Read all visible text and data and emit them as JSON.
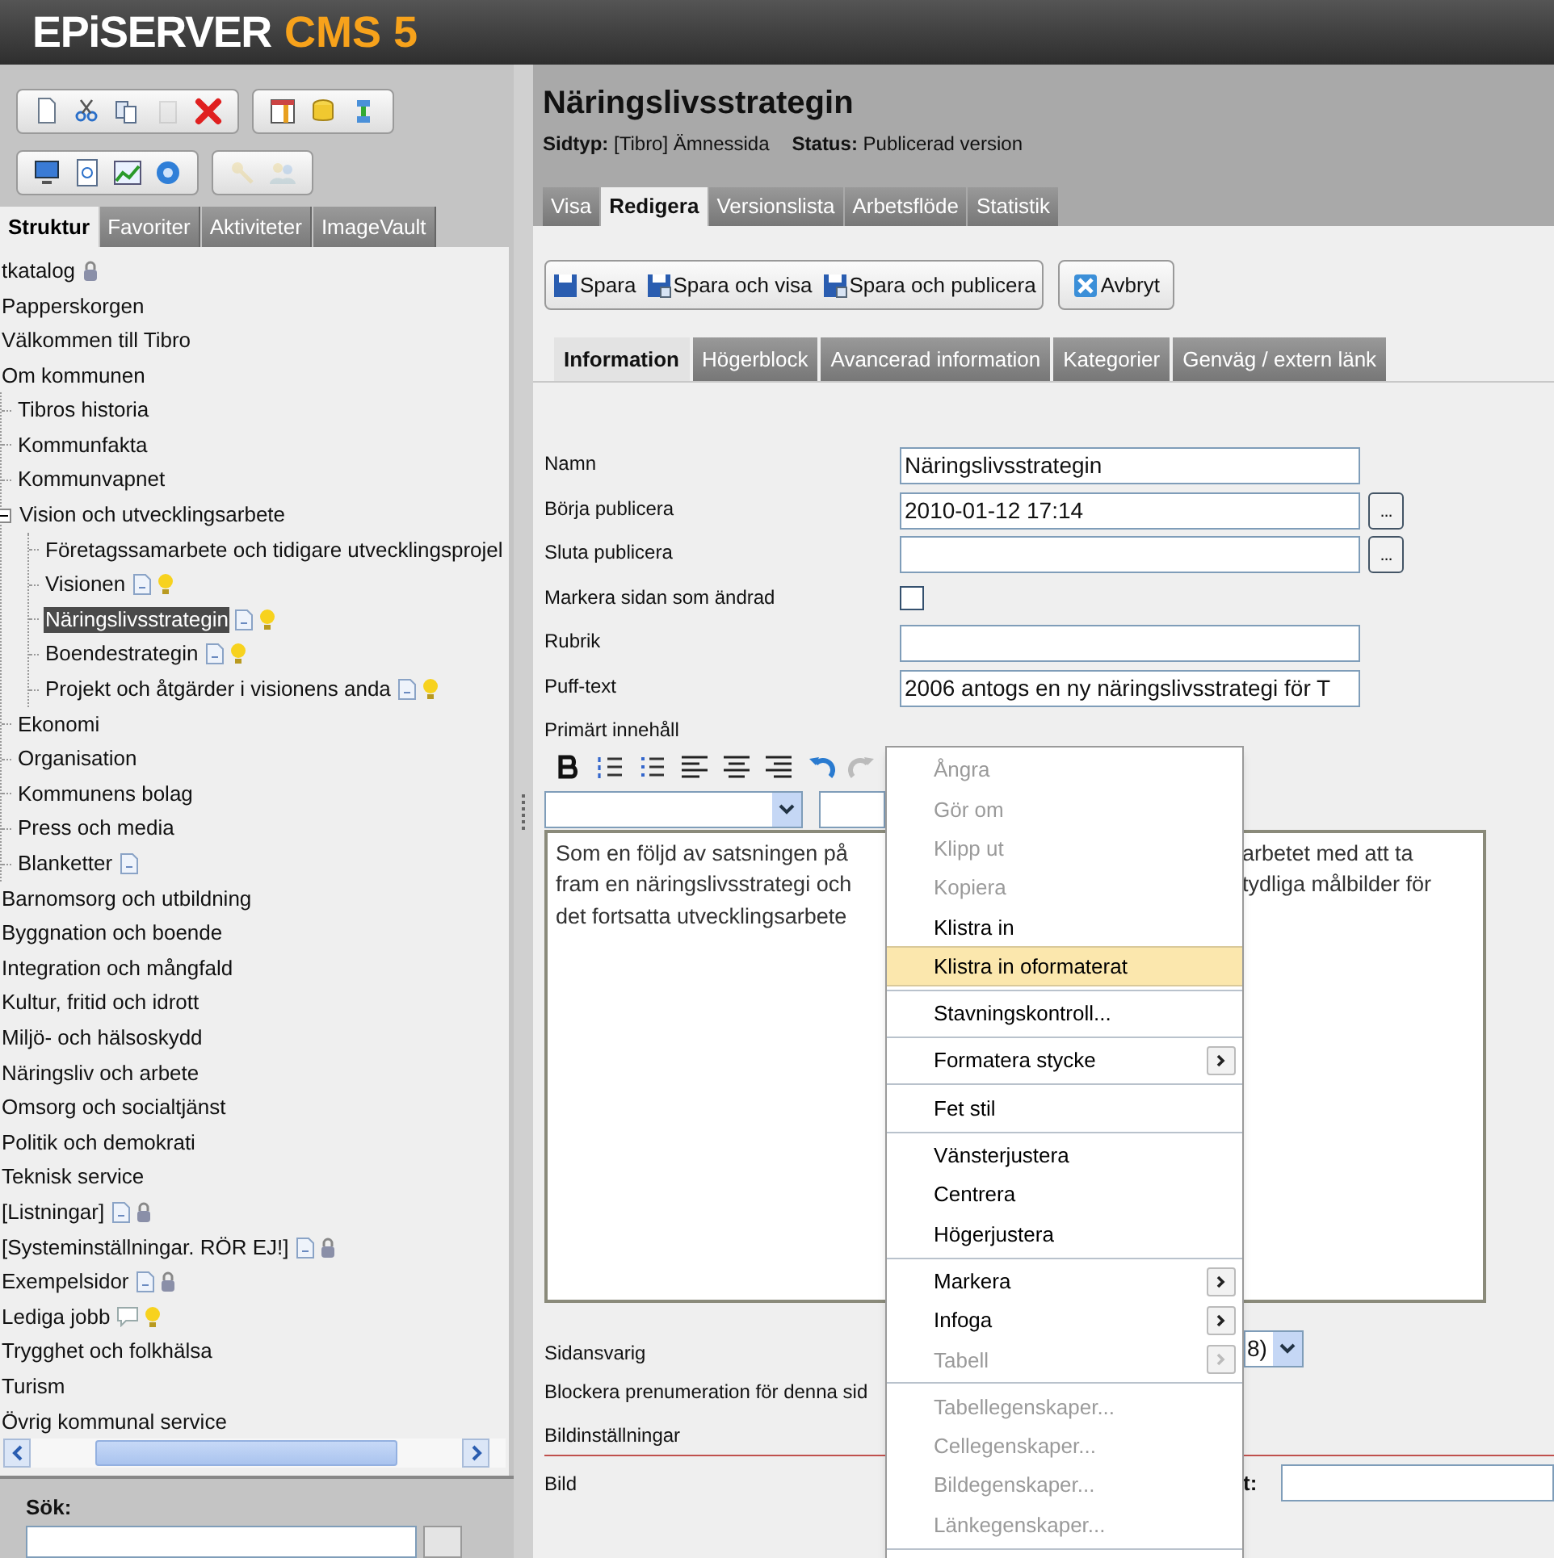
{
  "header": {
    "logo_main": "EPiSERVER",
    "logo_product": "CMS 5"
  },
  "left_toolbar": [
    [
      [
        {
          "disabled": false
        },
        {
          "disabled": false
        },
        {
          "disabled": false
        },
        {
          "disabled": true
        },
        {
          "disabled": false
        }
      ],
      [
        {
          "disabled": false
        },
        {
          "disabled": false
        },
        {
          "disabled": false
        }
      ]
    ],
    [
      [
        {
          "disabled": false
        },
        {
          "disabled": false
        },
        {
          "disabled": false
        },
        {
          "disabled": false
        }
      ],
      [
        {
          "disabled": true
        },
        {
          "disabled": true
        }
      ]
    ]
  ],
  "left_tabs": [
    {
      "label": "Struktur",
      "selected": true
    },
    {
      "label": "Favoriter",
      "selected": false
    },
    {
      "label": "Aktiviteter",
      "selected": false
    },
    {
      "label": "ImageVault",
      "selected": false
    }
  ],
  "tree": [
    {
      "label": "tkatalog",
      "selected": false,
      "lock_icon": true
    },
    {
      "label": "Papperskorgen",
      "selected": false
    },
    {
      "label": "Välkommen till Tibro",
      "selected": false
    },
    {
      "label": "Om kommunen",
      "selected": false,
      "children": [
        {
          "label": "Tibros historia",
          "selected": false
        },
        {
          "label": "Kommunfakta",
          "selected": false
        },
        {
          "label": "Kommunvapnet",
          "selected": false
        },
        {
          "label": "Vision och utvecklingsarbete",
          "selected": false,
          "expanded": true,
          "children": [
            {
              "label": "Företagssamarbete och tidigare utvecklingsprojel",
              "selected": false
            },
            {
              "label": "Visionen",
              "selected": false,
              "page_icon": true,
              "bulb_icon": true
            },
            {
              "label": "Näringslivsstrategin",
              "selected": true,
              "page_icon": true,
              "bulb_icon": true
            },
            {
              "label": "Boendestrategin",
              "selected": false,
              "page_icon": true,
              "bulb_icon": true
            },
            {
              "label": "Projekt och åtgärder i visionens anda",
              "selected": false,
              "page_icon": true,
              "bulb_icon": true
            }
          ]
        },
        {
          "label": "Ekonomi",
          "selected": false
        },
        {
          "label": "Organisation",
          "selected": false
        },
        {
          "label": "Kommunens bolag",
          "selected": false
        },
        {
          "label": "Press och media",
          "selected": false
        },
        {
          "label": "Blanketter",
          "selected": false,
          "page_icon": true
        }
      ]
    },
    {
      "label": "Barnomsorg och utbildning",
      "selected": false
    },
    {
      "label": "Byggnation och boende",
      "selected": false
    },
    {
      "label": "Integration och mångfald",
      "selected": false
    },
    {
      "label": "Kultur, fritid och idrott",
      "selected": false
    },
    {
      "label": "Miljö- och hälsoskydd",
      "selected": false
    },
    {
      "label": "Näringsliv och arbete",
      "selected": false
    },
    {
      "label": "Omsorg och socialtjänst",
      "selected": false
    },
    {
      "label": "Politik och demokrati",
      "selected": false
    },
    {
      "label": "Teknisk service",
      "selected": false
    },
    {
      "label": "[Listningar]",
      "selected": false,
      "page_icon": true,
      "lock_icon": true
    },
    {
      "label": "[Systeminställningar. RÖR EJ!]",
      "selected": false,
      "page_icon": true,
      "lock_icon": true
    },
    {
      "label": "Exempelsidor",
      "selected": false,
      "page_icon": true,
      "lock_icon": true
    },
    {
      "label": "Lediga jobb",
      "selected": false,
      "bubble_icon": true,
      "bulb_icon": true
    },
    {
      "label": "Trygghet och folkhälsa",
      "selected": false
    },
    {
      "label": "Turism",
      "selected": false
    },
    {
      "label": "Övrig kommunal service",
      "selected": false
    }
  ],
  "search": {
    "label": "Sök:"
  },
  "page": {
    "title": "Näringslivsstrategin",
    "meta": [
      {
        "label": "Sidtyp:",
        "value": "[Tibro] Ämnessida"
      },
      {
        "label": "Status:",
        "value": "Publicerad version"
      }
    ]
  },
  "tabs": [
    {
      "label": "Visa",
      "selected": false
    },
    {
      "label": "Redigera",
      "selected": true
    },
    {
      "label": "Versionslista",
      "selected": false
    },
    {
      "label": "Arbetsflöde",
      "selected": false
    },
    {
      "label": "Statistik",
      "selected": false
    }
  ],
  "actions": [
    {
      "label": "Spara"
    },
    {
      "label": "Spara och visa"
    },
    {
      "label": "Spara och publicera"
    }
  ],
  "cancel": {
    "label": "Avbryt"
  },
  "subtabs": [
    {
      "label": "Information",
      "selected": true
    },
    {
      "label": "Högerblock",
      "selected": false
    },
    {
      "label": "Avancerad information",
      "selected": false
    },
    {
      "label": "Kategorier",
      "selected": false
    },
    {
      "label": "Genväg / extern länk",
      "selected": false
    }
  ],
  "fields": [
    {
      "kind": "text",
      "label": "Namn",
      "value": "Näringslivsstrategin"
    },
    {
      "kind": "date",
      "label": "Börja publicera",
      "value": "2010-01-12 17:14",
      "picker": "..."
    },
    {
      "kind": "date",
      "label": "Sluta publicera",
      "picker": "..."
    },
    {
      "kind": "checkbox",
      "label": "Markera sidan som ändrad",
      "checked": false
    },
    {
      "kind": "text",
      "label": "Rubrik"
    },
    {
      "kind": "text",
      "label": "Puff-text",
      "value": "2006 antogs en ny näringslivsstrategi för T"
    }
  ],
  "editor": {
    "label": "Primärt innehåll",
    "text_left": [
      "Som en följd av satsningen på",
      "fram en näringslivsstrategi och",
      "det fortsatta utvecklingsarbete"
    ],
    "text_right": [
      "arbetet med att ta",
      "tydliga målbilder för"
    ]
  },
  "lower": [
    {
      "kind": "select",
      "label": "Sidansvarig",
      "value": "8)"
    },
    {
      "kind": "plain",
      "label": "Blockera prenumeration för denna sid"
    },
    {
      "kind": "section",
      "label": "Bildinställningar"
    },
    {
      "kind": "image",
      "label": "Bild",
      "side_label": "t:"
    }
  ],
  "context_menu": [
    [
      {
        "label": "Ångra",
        "disabled": true,
        "selected": false,
        "submenu": false
      },
      {
        "label": "Gör om",
        "disabled": true,
        "selected": false,
        "submenu": false
      },
      {
        "label": "Klipp ut",
        "disabled": true,
        "selected": false,
        "submenu": false
      },
      {
        "label": "Kopiera",
        "disabled": true,
        "selected": false,
        "submenu": false
      },
      {
        "label": "Klistra in",
        "disabled": false,
        "selected": false,
        "submenu": false
      },
      {
        "label": "Klistra in oformaterat",
        "disabled": false,
        "selected": true,
        "submenu": false
      }
    ],
    [
      {
        "label": "Stavningskontroll...",
        "disabled": false,
        "selected": false,
        "submenu": false
      }
    ],
    [
      {
        "label": "Formatera stycke",
        "disabled": false,
        "selected": false,
        "submenu": true
      }
    ],
    [
      {
        "label": "Fet stil",
        "disabled": false,
        "selected": false,
        "submenu": false
      }
    ],
    [
      {
        "label": "Vänsterjustera",
        "disabled": false,
        "selected": false,
        "submenu": false
      },
      {
        "label": "Centrera",
        "disabled": false,
        "selected": false,
        "submenu": false
      },
      {
        "label": "Högerjustera",
        "disabled": false,
        "selected": false,
        "submenu": false
      }
    ],
    [
      {
        "label": "Markera",
        "disabled": false,
        "selected": false,
        "submenu": true
      },
      {
        "label": "Infoga",
        "disabled": false,
        "selected": false,
        "submenu": true
      },
      {
        "label": "Tabell",
        "disabled": true,
        "selected": false,
        "submenu": true
      }
    ],
    [
      {
        "label": "Tabellegenskaper...",
        "disabled": true,
        "selected": false,
        "submenu": false
      },
      {
        "label": "Cellegenskaper...",
        "disabled": true,
        "selected": false,
        "submenu": false
      },
      {
        "label": "Bildegenskaper...",
        "disabled": true,
        "selected": false,
        "submenu": false
      },
      {
        "label": "Länkegenskaper...",
        "disabled": true,
        "selected": false,
        "submenu": false
      }
    ]
  ]
}
